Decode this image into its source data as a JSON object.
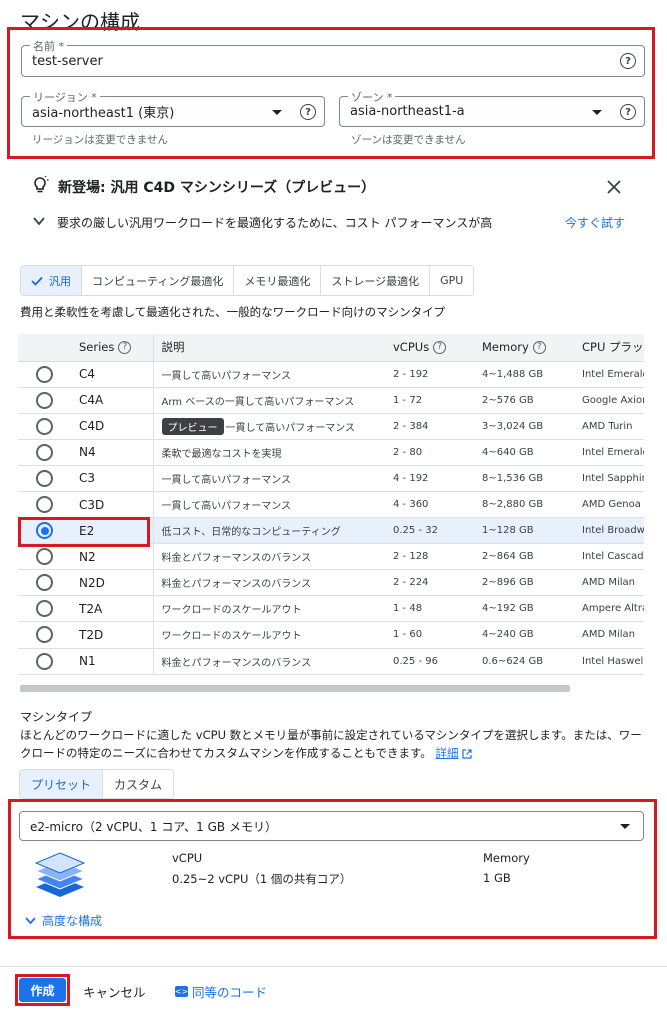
{
  "page_title": "マシンの構成",
  "name_field": {
    "label": "名前 *",
    "value": "test-server"
  },
  "region_field": {
    "label": "リージョン *",
    "value": "asia-northeast1 (東京)",
    "hint": "リージョンは変更できません"
  },
  "zone_field": {
    "label": "ゾーン *",
    "value": "asia-northeast1-a",
    "hint": "ゾーンは変更できません"
  },
  "banner": {
    "title": "新登場: 汎用 C4D マシンシリーズ（プレビュー）",
    "description": "要求の厳しい汎用ワークロードを最適化するために、コスト パフォーマンスが高",
    "try_link": "今すぐ試す"
  },
  "family_tabs": [
    {
      "label": "汎用",
      "active": true
    },
    {
      "label": "コンピューティング最適化",
      "active": false
    },
    {
      "label": "メモリ最適化",
      "active": false
    },
    {
      "label": "ストレージ最適化",
      "active": false
    },
    {
      "label": "GPU",
      "active": false
    }
  ],
  "family_description": "費用と柔軟性を考慮して最適化された、一般的なワークロード向けのマシンタイプ",
  "series_table": {
    "headers": {
      "series": "Series",
      "description": "説明",
      "vcpus": "vCPUs",
      "memory": "Memory",
      "cpu_platform": "CPU プラッ"
    },
    "preview_chip": "プレビュー",
    "rows": [
      {
        "series": "C4",
        "description": "一貫して高いパフォーマンス",
        "vcpus": "2 - 192",
        "memory": "4~1,488 GB",
        "cpu": "Intel Emerald",
        "selected": false
      },
      {
        "series": "C4A",
        "description": "Arm ベースの一貫して高いパフォーマンス",
        "vcpus": "1 - 72",
        "memory": "2~576 GB",
        "cpu": "Google Axion",
        "selected": false
      },
      {
        "series": "C4D",
        "description": "一貫して高いパフォーマンス",
        "vcpus": "2 - 384",
        "memory": "3~3,024 GB",
        "cpu": "AMD Turin",
        "selected": false
      },
      {
        "series": "N4",
        "description": "柔軟で最適なコストを実現",
        "vcpus": "2 - 80",
        "memory": "4~640 GB",
        "cpu": "Intel Emerald",
        "selected": false
      },
      {
        "series": "C3",
        "description": "一貫して高いパフォーマンス",
        "vcpus": "4 - 192",
        "memory": "8~1,536 GB",
        "cpu": "Intel Sapphire",
        "selected": false
      },
      {
        "series": "C3D",
        "description": "一貫して高いパフォーマンス",
        "vcpus": "4 - 360",
        "memory": "8~2,880 GB",
        "cpu": "AMD Genoa",
        "selected": false
      },
      {
        "series": "E2",
        "description": "低コスト、日常的なコンピューティング",
        "vcpus": "0.25 - 32",
        "memory": "1~128 GB",
        "cpu": "Intel Broadwell",
        "selected": true
      },
      {
        "series": "N2",
        "description": "料金とパフォーマンスのバランス",
        "vcpus": "2 - 128",
        "memory": "2~864 GB",
        "cpu": "Intel Cascade",
        "selected": false
      },
      {
        "series": "N2D",
        "description": "料金とパフォーマンスのバランス",
        "vcpus": "2 - 224",
        "memory": "2~896 GB",
        "cpu": "AMD Milan",
        "selected": false
      },
      {
        "series": "T2A",
        "description": "ワークロードのスケールアウト",
        "vcpus": "1 - 48",
        "memory": "4~192 GB",
        "cpu": "Ampere Altra",
        "selected": false
      },
      {
        "series": "T2D",
        "description": "ワークロードのスケールアウト",
        "vcpus": "1 - 60",
        "memory": "4~240 GB",
        "cpu": "AMD Milan",
        "selected": false
      },
      {
        "series": "N1",
        "description": "料金とパフォーマンスのバランス",
        "vcpus": "0.25 - 96",
        "memory": "0.6~624 GB",
        "cpu": "Intel Haswell",
        "selected": false
      }
    ]
  },
  "machine_type": {
    "title": "マシンタイプ",
    "description": "ほとんどのワークロードに適した vCPU 数とメモリ量が事前に設定されているマシンタイプを選択します。または、ワークロードの特定のニーズに合わせてカスタムマシンを作成することもできます。",
    "details_link": "詳細",
    "tabs": [
      "プリセット",
      "カスタム"
    ],
    "selected_type": "e2-micro（2 vCPU、1 コア、1 GB メモリ）",
    "vcpu_label": "vCPU",
    "vcpu_value": "0.25~2 vCPU（1 個の共有コア）",
    "memory_label": "Memory",
    "memory_value": "1 GB",
    "advanced": "高度な構成"
  },
  "footer": {
    "create": "作成",
    "cancel": "キャンセル",
    "equivalent_code": "同等のコード"
  }
}
